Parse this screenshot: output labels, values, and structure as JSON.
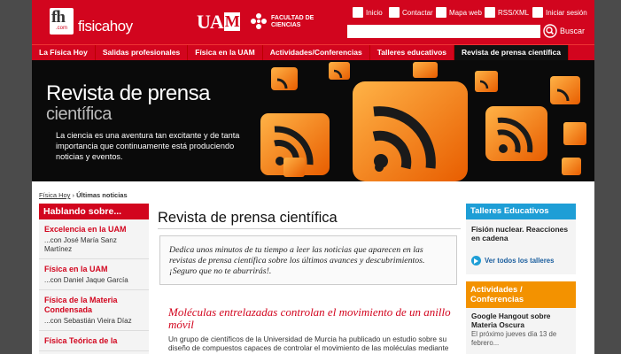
{
  "header": {
    "logo_fh": "fh",
    "logo_com": ".com",
    "site_name": "fisicahoy",
    "uam_text": "UA",
    "uam_box": "M",
    "faculty_line1": "FACULTAD DE",
    "faculty_line2": "CIENCIAS",
    "top_links": {
      "inicio": "Inicio",
      "contactar": "Contactar",
      "mapa": "Mapa web",
      "rss": "RSS/XML",
      "sesion": "Iniciar sesión"
    },
    "search": {
      "placeholder": "",
      "button_label": "Buscar"
    }
  },
  "nav": {
    "items": [
      "La Física Hoy",
      "Salidas profesionales",
      "Física en la UAM",
      "Actividades/Conferencias",
      "Talleres educativos",
      "Revista de prensa científica"
    ]
  },
  "banner": {
    "title_line1": "Revista de prensa",
    "title_line2": "científica",
    "description": "La ciencia es una aventura tan excitante y de tanta importancia que continuamente está produciendo noticias y eventos."
  },
  "breadcrumb": {
    "home": "Física Hoy",
    "separator": " › ",
    "current": "Últimas noticias"
  },
  "left": {
    "header": "Hablando sobre...",
    "items": [
      {
        "title": "Excelencia en la UAM",
        "subtitle": "...con José María Sanz Martínez"
      },
      {
        "title": "Física en la UAM",
        "subtitle": "...con Daniel Jaque García"
      },
      {
        "title": "Física de la Materia Condensada",
        "subtitle": "...con Sebastián Vieira Díaz"
      },
      {
        "title": "Física Teórica de la",
        "subtitle": ""
      }
    ]
  },
  "main": {
    "title": "Revista de prensa científica",
    "intro": "Dedica unos minutos de tu tiempo a leer las noticias que aparecen en las revistas de prensa científica sobre los últimos avances y descubrimientos. ¡Seguro que no te aburrirás!.",
    "article_title": "Moléculas entrelazadas controlan el movimiento de un anillo móvil",
    "article_text": "Un grupo de científicos de la Universidad de Murcia ha publicado un estudio sobre su diseño de compuestos capaces de controlar el movimiento de las moléculas mediante el"
  },
  "right": {
    "talleres_header": "Talleres Educativos",
    "talleres_item": "Fisión nuclear. Reacciones en cadena",
    "talleres_link": "Ver todos los talleres",
    "act_header": "Actividades / Conferencias",
    "act_item": "Google Hangout sobre Materia Oscura",
    "act_date": "El próximo jueves día 13 de febrero..."
  },
  "colors": {
    "brand_red": "#d2051e",
    "blue": "#1e9ed6",
    "orange": "#f39200",
    "dark": "#111111"
  }
}
